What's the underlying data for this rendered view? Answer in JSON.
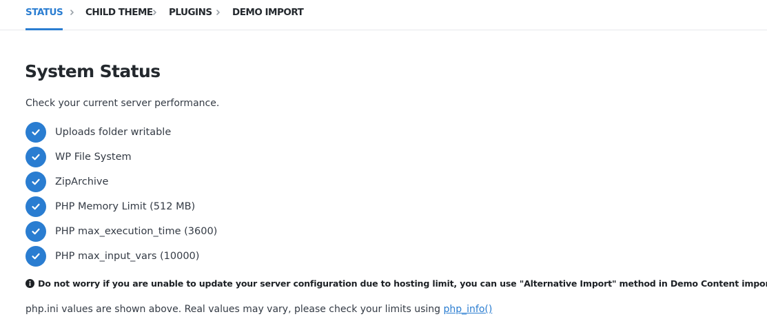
{
  "nav": {
    "steps": [
      {
        "label": "STATUS",
        "active": true
      },
      {
        "label": "CHILD THEME",
        "active": false
      },
      {
        "label": "PLUGINS",
        "active": false
      },
      {
        "label": "DEMO IMPORT",
        "active": false
      }
    ],
    "separator_icon": "chevron-right-icon"
  },
  "main": {
    "title": "System Status",
    "intro": "Check your current server performance.",
    "checks": [
      {
        "label": "Uploads folder writable",
        "status": "ok",
        "icon": "check-circle-icon"
      },
      {
        "label": "WP File System",
        "status": "ok",
        "icon": "check-circle-icon"
      },
      {
        "label": "ZipArchive",
        "status": "ok",
        "icon": "check-circle-icon"
      },
      {
        "label": "PHP Memory Limit (512 MB)",
        "status": "ok",
        "icon": "check-circle-icon"
      },
      {
        "label": "PHP max_execution_time (3600)",
        "status": "ok",
        "icon": "check-circle-icon"
      },
      {
        "label": "PHP max_input_vars (10000)",
        "status": "ok",
        "icon": "check-circle-icon"
      }
    ],
    "notice": {
      "icon": "info-circle-icon",
      "text": "Do not worry if you are unable to update your server configuration due to hosting limit, you can use \"Alternative Import\" method in Demo Content import page."
    },
    "footer": {
      "text": "php.ini values are shown above. Real values may vary, please check your limits using ",
      "link_label": "php_info()"
    }
  },
  "colors": {
    "accent": "#2a7dd1",
    "text": "#333a44",
    "heading": "#23282d",
    "divider": "#e6e8eb"
  }
}
